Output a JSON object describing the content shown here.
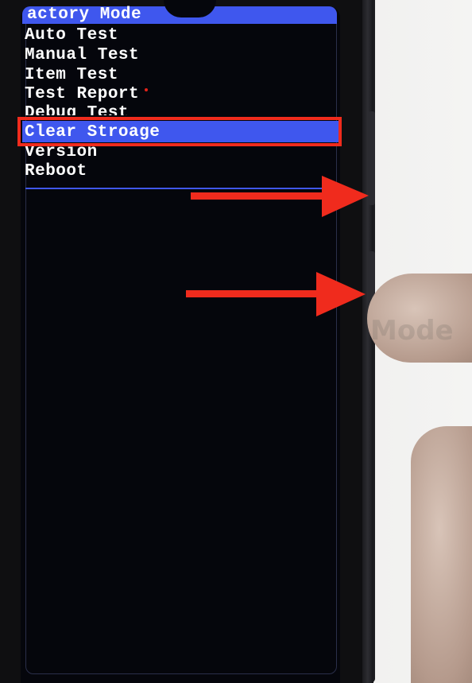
{
  "menu": {
    "title": "actory Mode",
    "items": [
      {
        "label": "Auto Test"
      },
      {
        "label": "Manual Test"
      },
      {
        "label": "Item Test"
      },
      {
        "label": "Test Report"
      },
      {
        "label": "Debug Test"
      },
      {
        "label": "Clear Stroage",
        "selected": true
      },
      {
        "label": "Version"
      },
      {
        "label": "Reboot"
      }
    ]
  },
  "watermark": "Mode",
  "colors": {
    "menu_highlight": "#3f57ee",
    "annotation_red": "#f02b1d",
    "screen_background": "#05060c",
    "text": "#ffffff"
  },
  "icons": {
    "annotation_arrows": [
      "arrow-right-icon",
      "arrow-right-icon"
    ]
  }
}
